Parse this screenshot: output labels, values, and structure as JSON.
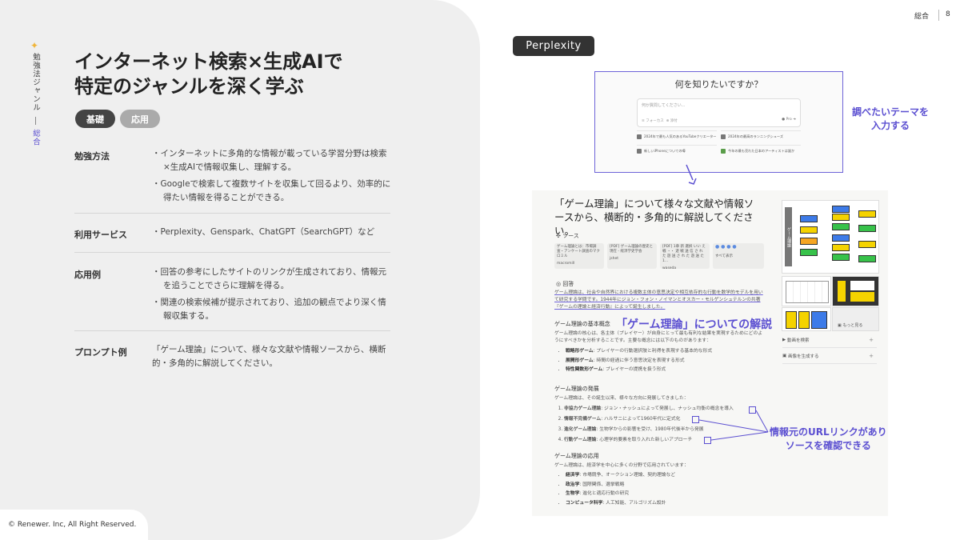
{
  "sidebar": {
    "genre_title": "勉強法ジャンル",
    "genre_current": "総合"
  },
  "title": {
    "line1": "インターネット検索×生成AIで",
    "line2": "特定のジャンルを深く学ぶ"
  },
  "tabs": [
    {
      "label": "基礎",
      "active": true
    },
    {
      "label": "応用",
      "active": false
    }
  ],
  "rows": [
    {
      "label": "勉強方法",
      "bullets": [
        "・インターネットに多角的な情報が載っている学習分野は検索×生成AIで情報収集し、理解する。",
        "・Googleで検索して複数サイトを収集して回るより、効率的に得たい情報を得ることができる。"
      ]
    },
    {
      "label": "利用サービス",
      "bullets": [
        "・Perplexity、Genspark、ChatGPT（SearchGPT）など"
      ]
    },
    {
      "label": "応用例",
      "bullets": [
        "・回答の参考にしたサイトのリンクが生成されており、情報元を追うことでさらに理解を得る。",
        "・関連の検索候補が提示されており、追加の観点でより深く情報収集する。"
      ]
    },
    {
      "label": "プロンプト例",
      "bullets": [
        "「ゲーム理論」について、様々な文献や情報ソースから、横断的・多角的に解説してください。"
      ]
    }
  ],
  "header": {
    "section": "総合",
    "page": "8"
  },
  "footer": {
    "copyright": "© Renewer. Inc, All Right Reserved."
  },
  "screenshot": {
    "service_label": "Perplexity",
    "search": {
      "question": "何を知りたいですか？",
      "placeholder": "何か質問してください...",
      "focus": "フォーカス",
      "attach": "添付",
      "pro": "Pro",
      "suggestions": [
        "2024年で最も人気のあるYouTubeクリエーター",
        "2024年の最高のランニングシューズ",
        "新しいiPhoneについての噂",
        "今年の最も売れた日本のアーティストは誰か"
      ]
    },
    "note_input": "調べたいテーマを\n入力する",
    "result": {
      "title": "「ゲーム理論」について様々な文献や情報ソースから、横断的・多角的に解説してください。",
      "sources_label": "ソース",
      "source_cards": [
        {
          "title": "ゲーム理論とは：市場調査・アンケート調査のマクロミル",
          "site": "macromill"
        },
        {
          "title": "[PDF] ゲーム理論の歴史と現在 - 経済学史学会",
          "site": "jshet"
        },
        {
          "title": "[PDF] 1章 新 選択 いい え 戦 ・・ 遊 戦 送 信 さ れ た 遊 送 さ れ た 遊 送 た 1...",
          "site": "waseda"
        },
        {
          "title": "すべて表示",
          "site": ""
        }
      ],
      "answer_label": "回答",
      "answer_intro": "ゲーム理論は、社会や自然界における複数主体の意思決定や相互依存的な行動を数学的モデルを用いて研究する学問です。1944年にジョン・フォン・ノイマンとオスカー・モルゲンシュテルンの共著『ゲームの理論と経済行動』によって誕生しました。",
      "section_basic": "ゲーム理論の基本概念",
      "basic_text": "ゲーム理論の核心は、各主体（プレイヤー）が自身にとって最も有利な結果を実現するためにどのようにすべきかを分析することです。主要な概念には以下のものがあります：",
      "basic_items": [
        {
          "term": "戦略形ゲーム",
          "desc": ": プレイヤーの行動選択肢と利得を表現する基本的な形式"
        },
        {
          "term": "展開形ゲーム",
          "desc": ": 時間の経過に伴う意思決定を表現する形式"
        },
        {
          "term": "特性関数形ゲーム",
          "desc": ": プレイヤーの提携を扱う形式"
        }
      ],
      "section_dev": "ゲーム理論の発展",
      "dev_text": "ゲーム理論は、その誕生以来、様々な方向に発展してきました：",
      "dev_items": [
        {
          "term": "非協力ゲーム理論",
          "desc": ": ジョン・ナッシュによって発展し、ナッシュ均衡の概念を導入"
        },
        {
          "term": "情報不完備ゲーム",
          "desc": ": ハルサニによって1960年代に定式化"
        },
        {
          "term": "進化ゲーム理論",
          "desc": ": 生物学からの影響を受け、1980年代後半から発展"
        },
        {
          "term": "行動ゲーム理論",
          "desc": ": 心理学的要素を取り入れた新しいアプローチ"
        }
      ],
      "section_app": "ゲーム理論の応用",
      "app_text": "ゲーム理論は、経済学を中心に多くの分野で応用されています：",
      "app_items": [
        {
          "term": "経済学",
          "desc": ": 市場競争、オークション理論、契約理論など"
        },
        {
          "term": "政治学",
          "desc": ": 国際関係、選挙戦略"
        },
        {
          "term": "生物学",
          "desc": ": 進化と適応行動の研究"
        },
        {
          "term": "コンピュータ科学",
          "desc": ": 人工知能、アルゴリズム設計"
        }
      ],
      "side_more": "もっと見る",
      "side_video": "動画を検索",
      "side_image": "画像を生成する",
      "diagram_label": "ゲーム理論"
    },
    "overlay_title": "「ゲーム理論」についての解説",
    "note_links": "情報元のURLリンクがあり\nソースを確認できる"
  },
  "colors": {
    "accent": "#5b4fd1",
    "star": "#f0b53a",
    "dark_chip": "#444444",
    "light_chip": "#aaaaaa"
  }
}
